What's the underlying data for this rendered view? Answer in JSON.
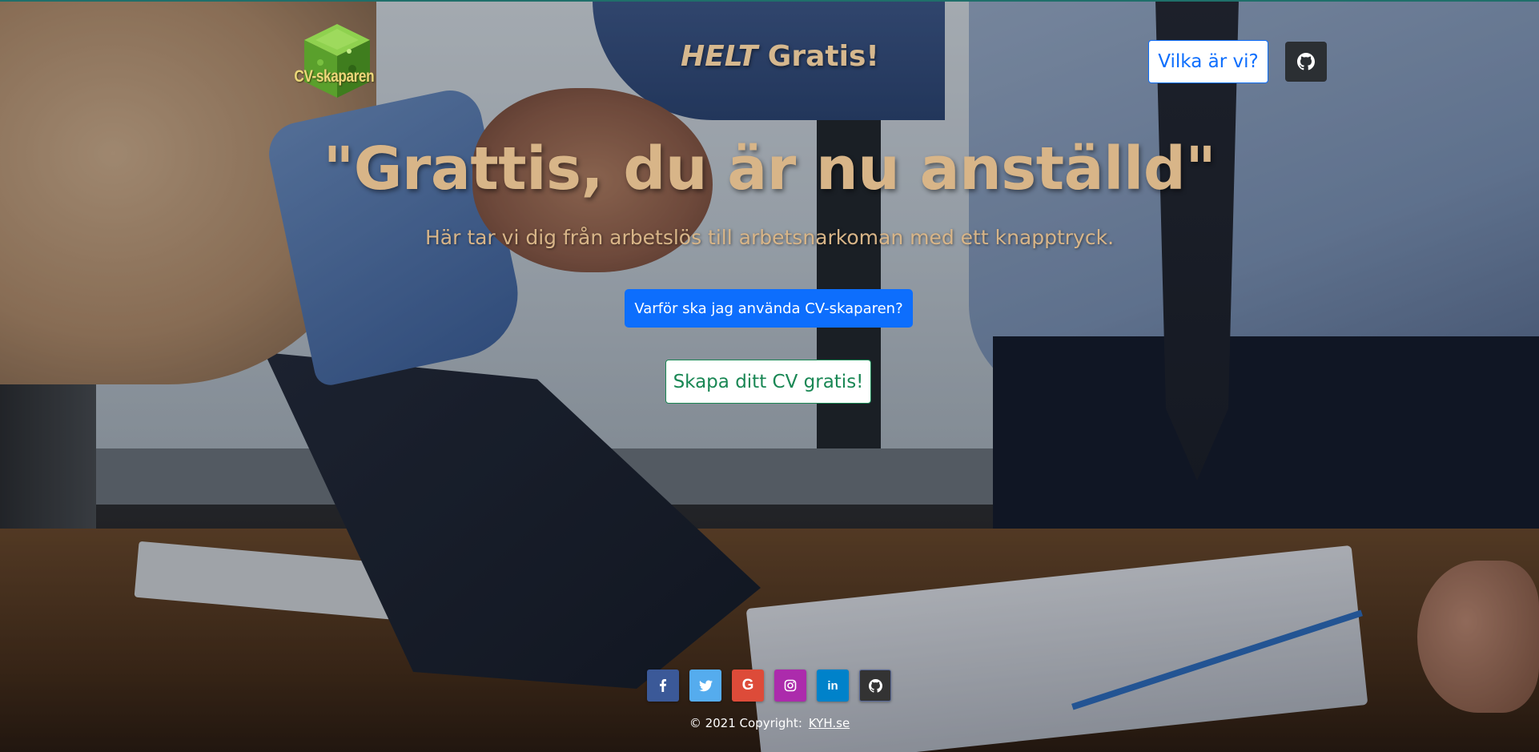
{
  "header": {
    "logo_text": "CV-skaparen",
    "tagline_emphasis": "HELT",
    "tagline_rest": " Gratis!",
    "who_button_label": "Vilka är vi?",
    "github_icon": "github-icon"
  },
  "hero": {
    "headline": "\"Grattis, du är nu anställd\"",
    "subheadline": "Här tar vi dig från arbetslös till arbetsnarkoman med ett knapptryck.",
    "why_button_label": "Varför ska jag använda CV-skaparen?",
    "create_button_label": "Skapa ditt CV gratis!"
  },
  "footer": {
    "social": [
      {
        "name": "facebook-icon",
        "glyph": "f",
        "color": "#3b5998"
      },
      {
        "name": "twitter-icon",
        "glyph": "t",
        "color": "#55acee"
      },
      {
        "name": "google-icon",
        "glyph": "G",
        "color": "#dd4b39"
      },
      {
        "name": "instagram-icon",
        "glyph": "◎",
        "color": "#ac2bac"
      },
      {
        "name": "linkedin-icon",
        "glyph": "in",
        "color": "#0082ca"
      },
      {
        "name": "github-icon",
        "glyph": "gh",
        "color": "#333333"
      }
    ],
    "copyright_text": "© 2021 Copyright:",
    "copyright_link": "KYH.se"
  },
  "colors": {
    "heading": "#d8b588",
    "primary": "#0d6efd",
    "success": "#198754"
  }
}
